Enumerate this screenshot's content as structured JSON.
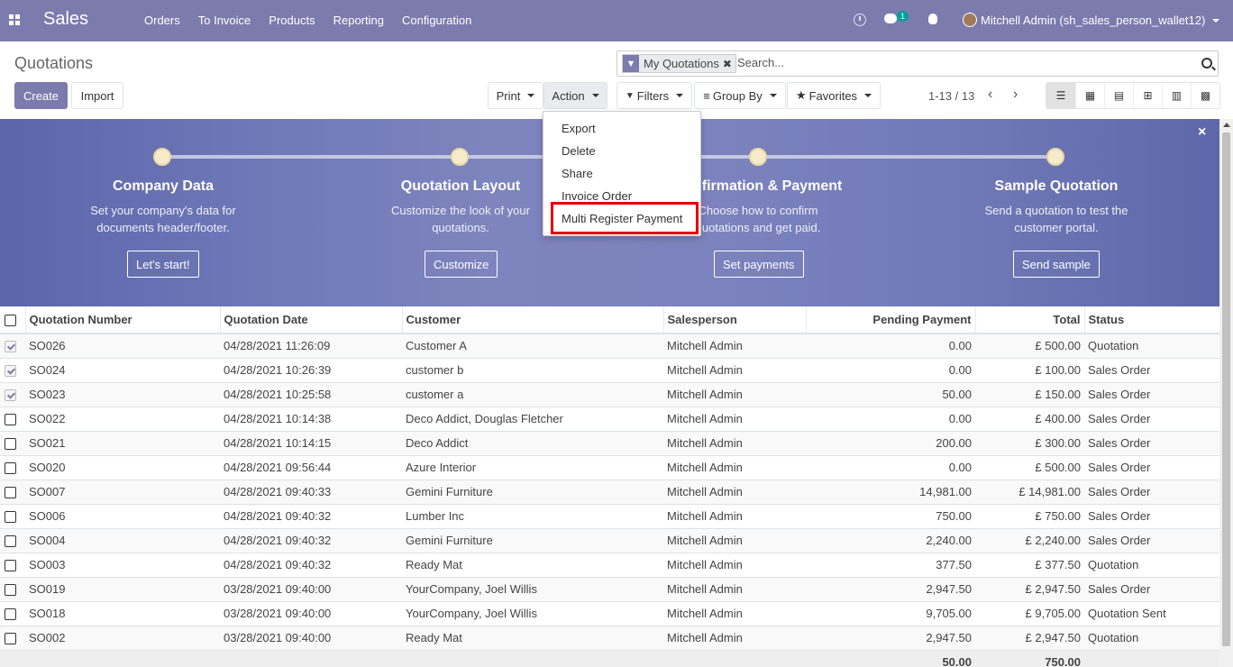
{
  "navbar": {
    "brand": "Sales",
    "menu": [
      "Orders",
      "To Invoice",
      "Products",
      "Reporting",
      "Configuration"
    ],
    "chat_badge": "1",
    "user": "Mitchell Admin (sh_sales_person_wallet12)"
  },
  "control_panel": {
    "breadcrumb": "Quotations",
    "create_label": "Create",
    "import_label": "Import",
    "print_label": "Print",
    "action_label": "Action",
    "filters_label": "Filters",
    "groupby_label": "Group By",
    "favorites_label": "Favorites",
    "search": {
      "facet": "My Quotations",
      "placeholder": "Search..."
    },
    "pager": "1-13 / 13",
    "views": [
      "list",
      "kanban",
      "calendar",
      "pivot",
      "graph",
      "grid"
    ]
  },
  "action_menu": {
    "items": [
      "Export",
      "Delete",
      "Share",
      "Invoice Order",
      "Multi Register Payment"
    ],
    "highlighted": "Multi Register Payment"
  },
  "banner": {
    "steps": [
      {
        "title": "Company Data",
        "desc": "Set your company's data for documents header/footer.",
        "button": "Let's start!"
      },
      {
        "title": "Quotation Layout",
        "desc": "Customize the look of your quotations.",
        "button": "Customize"
      },
      {
        "title": "Confirmation & Payment",
        "desc": "Choose how to confirm quotations and get paid.",
        "button": "Set payments"
      },
      {
        "title": "Sample Quotation",
        "desc": "Send a quotation to test the customer portal.",
        "button": "Send sample"
      }
    ],
    "close": "×"
  },
  "table": {
    "headers": [
      "Quotation Number",
      "Quotation Date",
      "Customer",
      "Salesperson",
      "Pending Payment",
      "Total",
      "Status"
    ],
    "rows": [
      {
        "checked": true,
        "number": "SO026",
        "date": "04/28/2021 11:26:09",
        "customer": "Customer A",
        "salesperson": "Mitchell Admin",
        "pending": "0.00",
        "total": "£ 500.00",
        "status": "Quotation"
      },
      {
        "checked": true,
        "number": "SO024",
        "date": "04/28/2021 10:26:39",
        "customer": "customer b",
        "salesperson": "Mitchell Admin",
        "pending": "0.00",
        "total": "£ 100.00",
        "status": "Sales Order"
      },
      {
        "checked": true,
        "number": "SO023",
        "date": "04/28/2021 10:25:58",
        "customer": "customer a",
        "salesperson": "Mitchell Admin",
        "pending": "50.00",
        "total": "£ 150.00",
        "status": "Sales Order"
      },
      {
        "checked": false,
        "number": "SO022",
        "date": "04/28/2021 10:14:38",
        "customer": "Deco Addict, Douglas Fletcher",
        "salesperson": "Mitchell Admin",
        "pending": "0.00",
        "total": "£ 400.00",
        "status": "Sales Order"
      },
      {
        "checked": false,
        "number": "SO021",
        "date": "04/28/2021 10:14:15",
        "customer": "Deco Addict",
        "salesperson": "Mitchell Admin",
        "pending": "200.00",
        "total": "£ 300.00",
        "status": "Sales Order"
      },
      {
        "checked": false,
        "number": "SO020",
        "date": "04/28/2021 09:56:44",
        "customer": "Azure Interior",
        "salesperson": "Mitchell Admin",
        "pending": "0.00",
        "total": "£ 500.00",
        "status": "Sales Order"
      },
      {
        "checked": false,
        "number": "SO007",
        "date": "04/28/2021 09:40:33",
        "customer": "Gemini Furniture",
        "salesperson": "Mitchell Admin",
        "pending": "14,981.00",
        "total": "£ 14,981.00",
        "status": "Sales Order"
      },
      {
        "checked": false,
        "number": "SO006",
        "date": "04/28/2021 09:40:32",
        "customer": "Lumber Inc",
        "salesperson": "Mitchell Admin",
        "pending": "750.00",
        "total": "£ 750.00",
        "status": "Sales Order"
      },
      {
        "checked": false,
        "number": "SO004",
        "date": "04/28/2021 09:40:32",
        "customer": "Gemini Furniture",
        "salesperson": "Mitchell Admin",
        "pending": "2,240.00",
        "total": "£ 2,240.00",
        "status": "Sales Order"
      },
      {
        "checked": false,
        "number": "SO003",
        "date": "04/28/2021 09:40:32",
        "customer": "Ready Mat",
        "salesperson": "Mitchell Admin",
        "pending": "377.50",
        "total": "£ 377.50",
        "status": "Quotation"
      },
      {
        "checked": false,
        "number": "SO019",
        "date": "03/28/2021 09:40:00",
        "customer": "YourCompany, Joel Willis",
        "salesperson": "Mitchell Admin",
        "pending": "2,947.50",
        "total": "£ 2,947.50",
        "status": "Sales Order"
      },
      {
        "checked": false,
        "number": "SO018",
        "date": "03/28/2021 09:40:00",
        "customer": "YourCompany, Joel Willis",
        "salesperson": "Mitchell Admin",
        "pending": "9,705.00",
        "total": "£ 9,705.00",
        "status": "Quotation Sent"
      },
      {
        "checked": false,
        "number": "SO002",
        "date": "03/28/2021 09:40:00",
        "customer": "Ready Mat",
        "salesperson": "Mitchell Admin",
        "pending": "2,947.50",
        "total": "£ 2,947.50",
        "status": "Quotation"
      }
    ],
    "footer": {
      "pending": "50.00",
      "total": "750.00"
    }
  },
  "colors": {
    "brand": "#7c7bad",
    "highlight": "#e00000"
  }
}
